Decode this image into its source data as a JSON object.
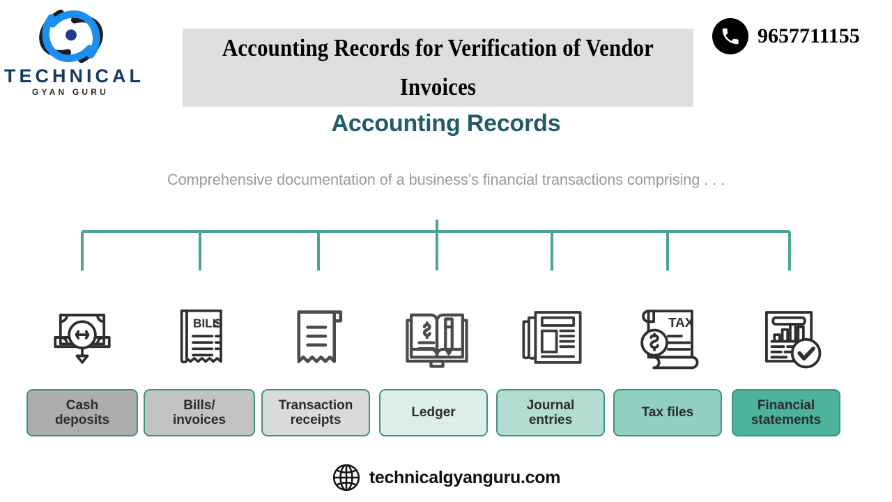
{
  "logo": {
    "wordmark": "TECHNICAL",
    "tagline": "GYAN GURU",
    "mark_icon": "atom-swirl-icon",
    "colors": {
      "primary": "#1b8ff0",
      "dark": "#1d1d1d",
      "word": "#173a63"
    }
  },
  "header": {
    "title": "Accounting Records for Verification of Vendor Invoices",
    "banner_bg": "#dedede",
    "phone_icon": "phone-icon",
    "phone_number": "9657711155"
  },
  "infographic": {
    "heading": "Accounting Records",
    "heading_color": "#215a68",
    "subheading": "Comprehensive documentation of a business’s financial transactions comprising . . .",
    "subheading_color": "#9a9a9a",
    "connector_color": "#4da394",
    "items": [
      {
        "label": "Cash\ndeposits",
        "label_line1": "Cash",
        "label_line2": "deposits",
        "icon": "cash-deposit-icon",
        "fill": "#adadad"
      },
      {
        "label": "Bills/\ninvoices",
        "label_line1": "Bills/",
        "label_line2": "invoices",
        "icon": "bill-invoice-icon",
        "fill": "#c3c3c3"
      },
      {
        "label": "Transaction\nreceipts",
        "label_line1": "Transaction",
        "label_line2": "receipts",
        "icon": "transaction-receipt-icon",
        "fill": "#dadada"
      },
      {
        "label": "Ledger",
        "label_line1": "Ledger",
        "label_line2": "",
        "icon": "ledger-book-icon",
        "fill": "#ddeee8"
      },
      {
        "label": "Journal\nentries",
        "label_line1": "Journal",
        "label_line2": "entries",
        "icon": "journal-newspaper-icon",
        "fill": "#b4ddd1"
      },
      {
        "label": "Tax files",
        "label_line1": "Tax files",
        "label_line2": "",
        "icon": "tax-file-icon",
        "fill": "#93d0c0"
      },
      {
        "label": "Financial\nstatements",
        "label_line1": "Financial",
        "label_line2": "statements",
        "icon": "financial-statement-icon",
        "fill": "#4cb39a"
      }
    ],
    "icon_labels": {
      "bill_text": "BILL",
      "bill_currency": "$",
      "tax_text": "TAX",
      "ledger_currency": "$",
      "cash_currency": "$"
    }
  },
  "footer": {
    "globe_icon": "globe-icon",
    "website": "technicalgyanguru.com"
  }
}
